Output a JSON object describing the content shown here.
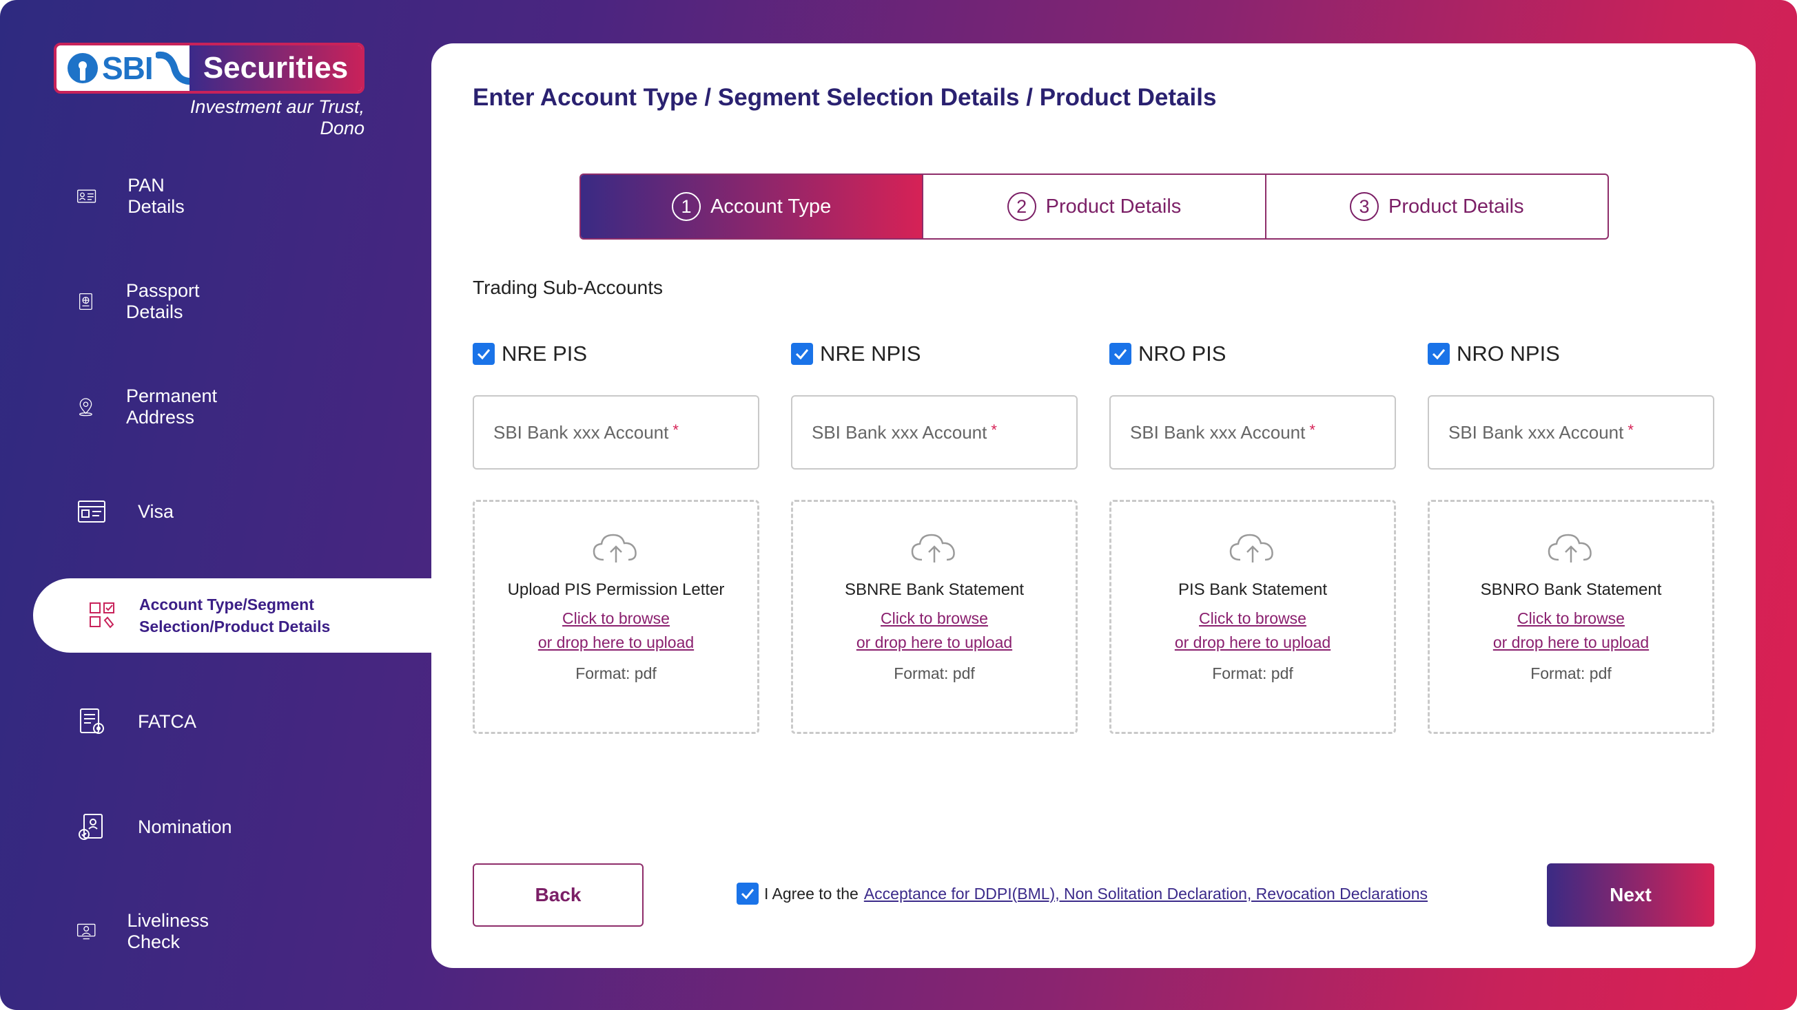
{
  "brand": {
    "logo_text": "SBI",
    "logo_secondary": "Securities",
    "tagline": "Investment aur Trust, Dono"
  },
  "sidebar": {
    "items": [
      {
        "label": "PAN Details",
        "icon": "id-card-icon"
      },
      {
        "label": "Passport Details",
        "icon": "passport-icon"
      },
      {
        "label": "Permanent Address",
        "icon": "location-pin-icon"
      },
      {
        "label": "Visa",
        "icon": "visa-card-icon"
      },
      {
        "label": "Account Type/Segment Selection/Product Details",
        "icon": "checklist-icon",
        "active": true
      },
      {
        "label": "FATCA",
        "icon": "document-settings-icon"
      },
      {
        "label": "Nomination",
        "icon": "nomination-icon"
      },
      {
        "label": "Liveliness Check",
        "icon": "monitor-user-icon"
      }
    ]
  },
  "main": {
    "title": "Enter Account Type / Segment Selection Details / Product Details",
    "steps": [
      {
        "num": "1",
        "label": "Account Type",
        "active": true
      },
      {
        "num": "2",
        "label": "Product Details",
        "active": false
      },
      {
        "num": "3",
        "label": "Product Details",
        "active": false
      }
    ],
    "section_title": "Trading Sub-Accounts",
    "sub_accounts": [
      {
        "label": "NRE PIS",
        "checked": true,
        "placeholder": "SBI Bank xxx Account",
        "required": "*",
        "upload_title": "Upload PIS Permission Letter",
        "browse": "Click to browse",
        "drop": "or drop here to upload",
        "format": "Format: pdf"
      },
      {
        "label": "NRE NPIS",
        "checked": true,
        "placeholder": "SBI Bank xxx Account",
        "required": "*",
        "upload_title": "SBNRE Bank Statement",
        "browse": "Click to browse",
        "drop": "or drop here to upload",
        "format": "Format: pdf"
      },
      {
        "label": "NRO PIS",
        "checked": true,
        "placeholder": "SBI Bank xxx Account",
        "required": "*",
        "upload_title": "PIS Bank Statement",
        "browse": "Click to browse",
        "drop": "or drop here to upload",
        "format": "Format: pdf"
      },
      {
        "label": "NRO NPIS",
        "checked": true,
        "placeholder": "SBI Bank xxx Account",
        "required": "*",
        "upload_title": "SBNRO Bank Statement",
        "browse": "Click to browse",
        "drop": "or drop here to upload",
        "format": "Format: pdf"
      }
    ],
    "footer": {
      "back_label": "Back",
      "agree_prefix": "I Agree to the",
      "agree_link": "Acceptance for DDPI(BML), Non Solitation Declaration, Revocation Declarations",
      "agree_checked": true,
      "next_label": "Next"
    }
  },
  "colors": {
    "brand_blue": "#1e73c8",
    "accent_purple": "#3a2a84",
    "accent_pink": "#d62256",
    "checkbox_blue": "#1a73e8"
  }
}
